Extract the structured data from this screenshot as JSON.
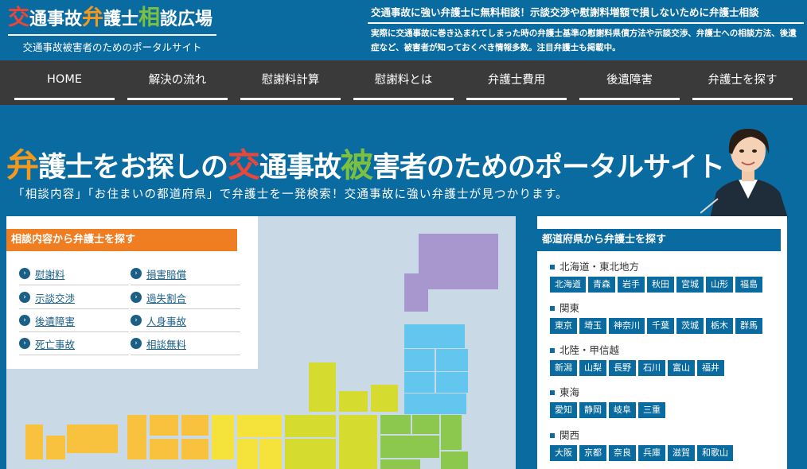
{
  "header": {
    "logo_parts": [
      {
        "text": "交",
        "color": "#e8473c"
      },
      {
        "text": "通事故",
        "color": "#ffffff"
      },
      {
        "text": "弁",
        "color": "#f39a1e"
      },
      {
        "text": "護士",
        "color": "#ffffff"
      },
      {
        "text": "相",
        "color": "#7cc040"
      },
      {
        "text": "談広場",
        "color": "#ffffff"
      }
    ],
    "logo_sub": "交通事故被害者のためのポータルサイト",
    "catch": "交通事故に強い弁護士に無料相談！示談交渉や慰謝料増額で損しないために弁護士相談",
    "desc": "実際に交通事故に巻き込まれてしまった時の弁護士基準の慰謝料県債方法や示談交渉、弁護士への相談方法、後遺症など、被害者が知っておくべき情報多数。注目弁護士も掲載中。"
  },
  "nav": {
    "items": [
      {
        "label": "HOME"
      },
      {
        "label": "解決の流れ"
      },
      {
        "label": "慰謝料計算"
      },
      {
        "label": "慰謝料とは"
      },
      {
        "label": "弁護士費用"
      },
      {
        "label": "後遺障害"
      },
      {
        "label": "弁護士を探す"
      }
    ]
  },
  "hero": {
    "title_parts": [
      {
        "text": "弁",
        "color": "#f39a1e",
        "hl": true
      },
      {
        "text": "護士をお探しの",
        "color": "#ffffff",
        "hl": false
      },
      {
        "text": "交",
        "color": "#e8473c",
        "hl": true
      },
      {
        "text": "通事故",
        "color": "#ffffff",
        "hl": false
      },
      {
        "text": "被",
        "color": "#7cc040",
        "hl": true
      },
      {
        "text": "害者のためのポータルサイト",
        "color": "#ffffff",
        "hl": false
      }
    ],
    "subtitle": "「相談内容」「お住まいの都道府県」で弁護士を一発検索！交通事故に強い弁護士が見つかります。"
  },
  "category_panel": {
    "title": "相談内容から弁護士を探す",
    "items": [
      {
        "label": "慰謝料"
      },
      {
        "label": "損害賠償"
      },
      {
        "label": "示談交渉"
      },
      {
        "label": "過失割合"
      },
      {
        "label": "後遺障害"
      },
      {
        "label": "人身事故"
      },
      {
        "label": "死亡事故"
      },
      {
        "label": "相談無料"
      }
    ]
  },
  "prefecture_panel": {
    "title": "都道府県から弁護士を探す",
    "regions": [
      {
        "name": "北海道・東北地方",
        "prefs": [
          "北海道",
          "青森",
          "岩手",
          "秋田",
          "宮城",
          "山形",
          "福島"
        ]
      },
      {
        "name": "関東",
        "prefs": [
          "東京",
          "埼玉",
          "神奈川",
          "千葉",
          "茨城",
          "栃木",
          "群馬"
        ]
      },
      {
        "name": "北陸・甲信越",
        "prefs": [
          "新潟",
          "山梨",
          "長野",
          "石川",
          "富山",
          "福井"
        ]
      },
      {
        "name": "東海",
        "prefs": [
          "愛知",
          "静岡",
          "岐阜",
          "三重"
        ]
      },
      {
        "name": "関西",
        "prefs": [
          "大阪",
          "京都",
          "奈良",
          "兵庫",
          "滋賀",
          "和歌山"
        ]
      }
    ]
  },
  "colors": {
    "header_bg": "#0a6ba0",
    "nav_bg": "#3a3a3a",
    "orange": "#ef7d22",
    "hokkaido": "#a897cf",
    "tohoku": "#62c6ee",
    "kanto": "#8cc74e",
    "chubu": "#d6dc2f",
    "kansai": "#f5e33c",
    "chugoku": "#f9c23e"
  }
}
